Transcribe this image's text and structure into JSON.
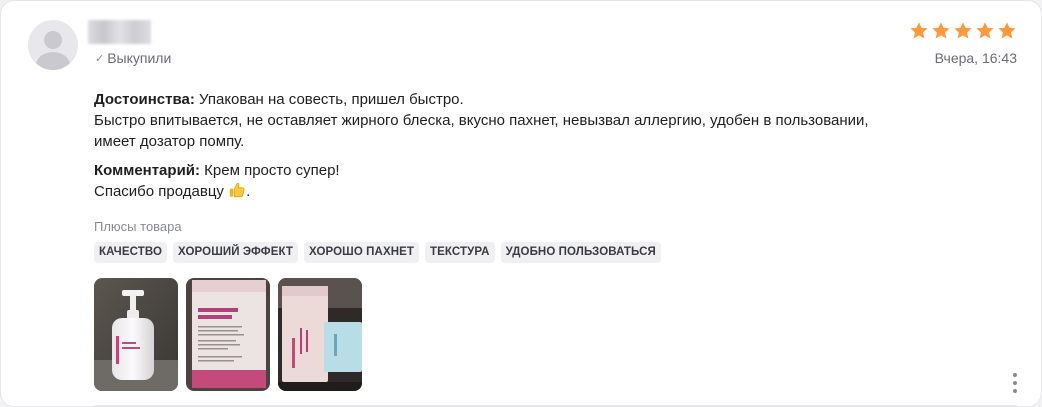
{
  "review": {
    "bought_label": "Выкупили",
    "date": "Вчера, 16:43",
    "rating": 5,
    "star_color": "#ff9a3c",
    "advantages_label": "Достоинства:",
    "advantages_line1": " Упакован на совесть, пришел быстро.",
    "advantages_line2": "Быстро впитывается, не оставляет жирного блеска, вкусно пахнет, невызвал аллергию, удобен в пользовании,",
    "advantages_line3": "имеет дозатор помпу.",
    "comment_label": "Комментарий:",
    "comment_line1": " Крем просто супер!",
    "comment_line2": "Спасибо продавцу ",
    "comment_end": "."
  },
  "pros": {
    "title": "Плюсы товара",
    "tags": [
      "КАЧЕСТВО",
      "ХОРОШИЙ ЭФФЕКТ",
      "ХОРОШО ПАХНЕТ",
      "ТЕКСТУРА",
      "УДОБНО ПОЛЬЗОВАТЬСЯ"
    ]
  }
}
